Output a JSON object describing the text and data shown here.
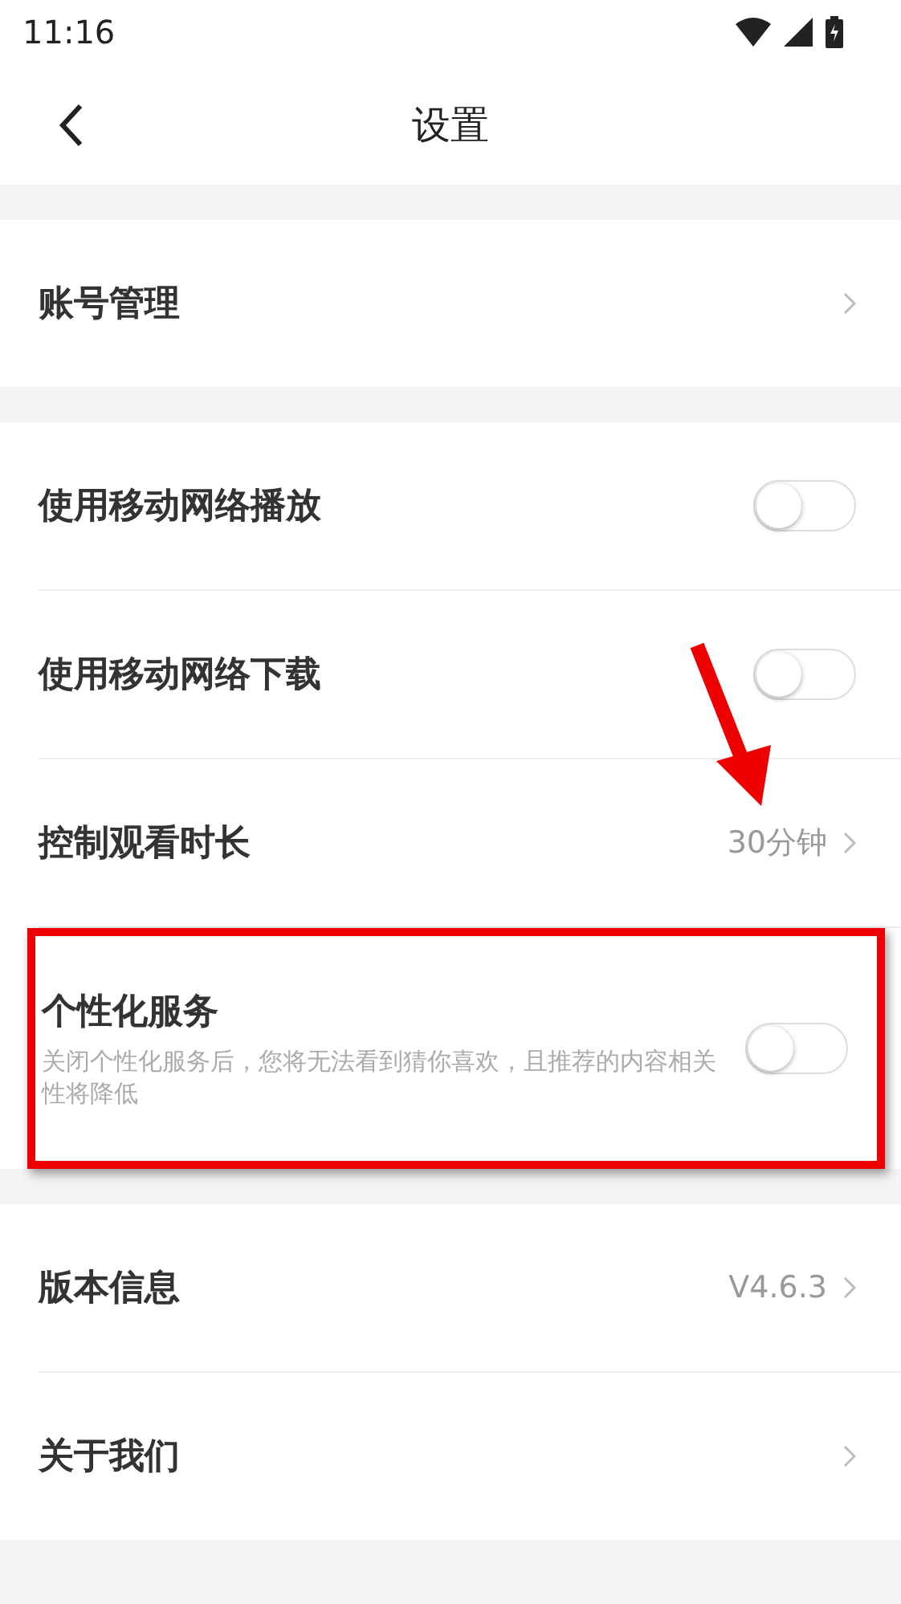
{
  "status_bar": {
    "time": "11:16"
  },
  "header": {
    "title": "设置"
  },
  "sections": [
    {
      "items": [
        {
          "kind": "link",
          "label": "账号管理"
        }
      ]
    },
    {
      "items": [
        {
          "kind": "toggle",
          "label": "使用移动网络播放",
          "on": false
        },
        {
          "kind": "toggle",
          "label": "使用移动网络下载",
          "on": false
        },
        {
          "kind": "link",
          "label": "控制观看时长",
          "value": "30分钟"
        },
        {
          "kind": "toggle",
          "label": "个性化服务",
          "description": "关闭个性化服务后，您将无法看到猜你喜欢，且推荐的内容相关性将降低",
          "on": false,
          "highlighted": true
        }
      ]
    },
    {
      "items": [
        {
          "kind": "link",
          "label": "版本信息",
          "value": "V4.6.3"
        },
        {
          "kind": "link",
          "label": "关于我们"
        }
      ]
    }
  ]
}
